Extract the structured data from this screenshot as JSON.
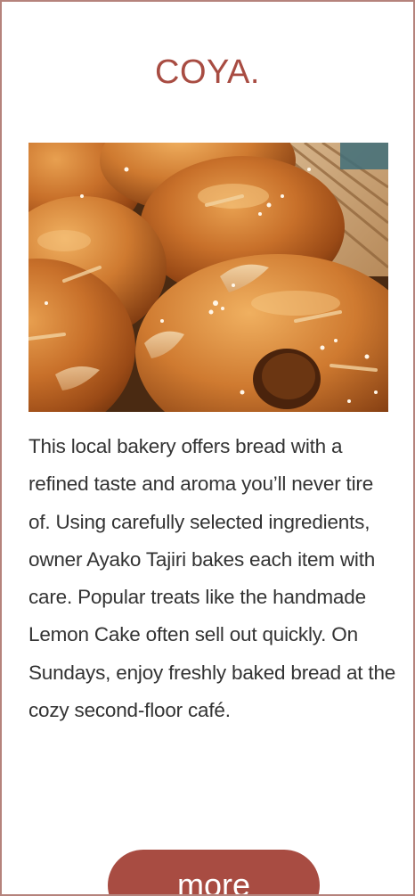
{
  "shop": {
    "name": "COYA.",
    "description": "This local bakery offers bread with a refined taste and aroma you’ll never tire of. Using carefully selected ingredients, owner Ayako Tajiri bakes each item with care. Popular treats like the handmade Lemon Cake often sell out quickly. On Sundays, enjoy freshly baked bread at the cozy second-floor café.",
    "photo_icon": "bagel-basket-photo"
  },
  "actions": {
    "more_label": "more"
  },
  "colors": {
    "accent": "#a84c42",
    "border": "#b5837c",
    "text": "#333333"
  }
}
